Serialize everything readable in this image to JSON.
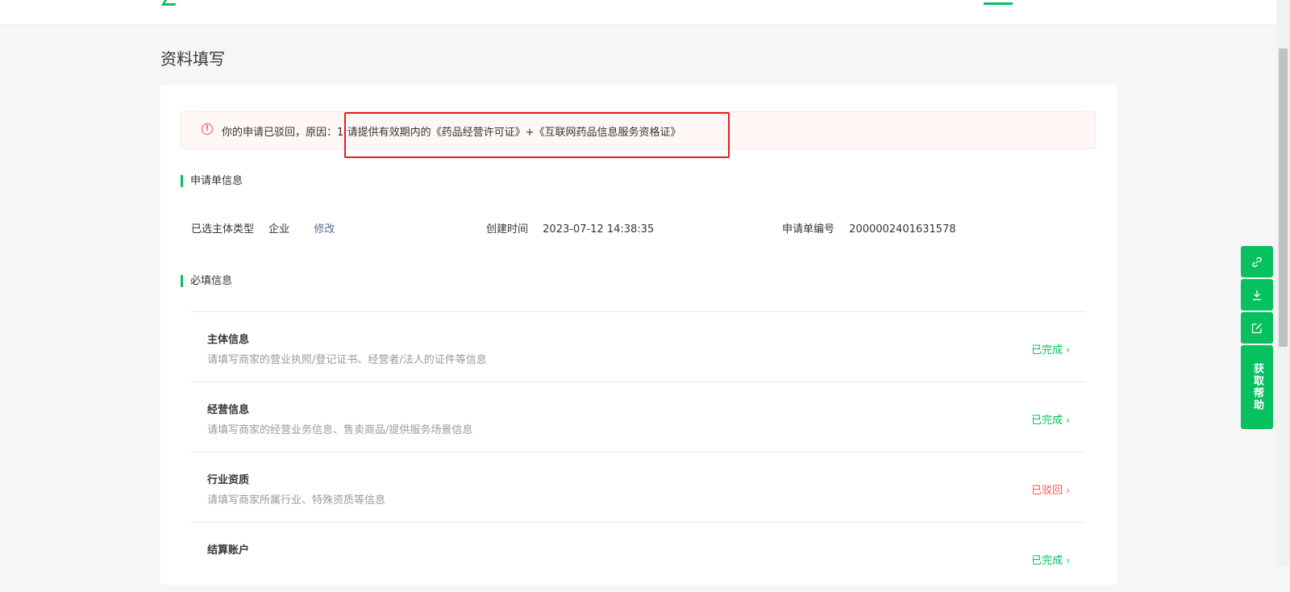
{
  "page": {
    "title": "资料填写"
  },
  "alert": {
    "prefix": "你的申请已驳回，原因：",
    "reason": "1:请提供有效期内的《药品经营许可证》+《互联网药品信息服务资格证》",
    "icon": "warning-circle-icon"
  },
  "application_info": {
    "heading": "申请单信息",
    "subject_type_label": "已选主体类型",
    "subject_type_value": "企业",
    "modify_link": "修改",
    "created_time_label": "创建时间",
    "created_time_value": "2023-07-12 14:38:35",
    "application_no_label": "申请单编号",
    "application_no_value": "2000002401631578"
  },
  "required_info": {
    "heading": "必填信息",
    "items": [
      {
        "title": "主体信息",
        "desc": "请填写商家的营业执照/登记证书、经营者/法人的证件等信息",
        "status": "已完成",
        "status_color": "#07c160"
      },
      {
        "title": "经营信息",
        "desc": "请填写商家的经营业务信息、售卖商品/提供服务场景信息",
        "status": "已完成",
        "status_color": "#07c160"
      },
      {
        "title": "行业资质",
        "desc": "请填写商家所属行业、特殊资质等信息",
        "status": "已驳回",
        "status_color": "#fa5151"
      },
      {
        "title": "结算账户",
        "desc": "",
        "status": "已完成",
        "status_color": "#07c160"
      }
    ]
  },
  "side_tools": {
    "help_label": "获取帮助"
  },
  "colors": {
    "accent": "#07c160",
    "danger": "#fa5151",
    "link": "#576b95"
  }
}
